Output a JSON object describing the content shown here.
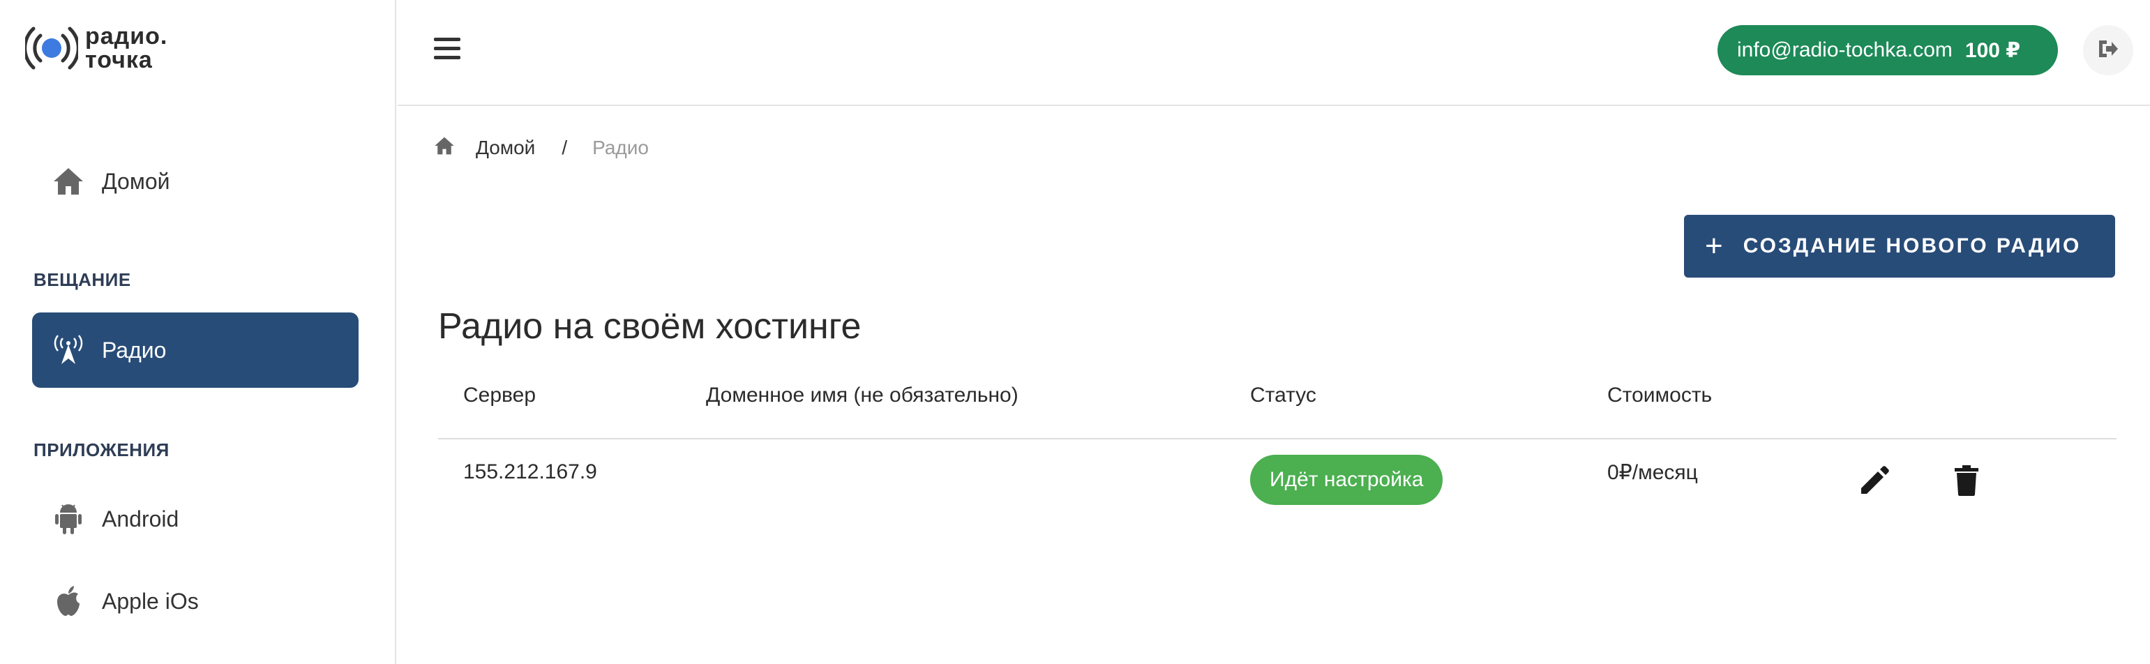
{
  "brand": {
    "line1": "радио.",
    "line2": "точка",
    "accent": "#3d7be0"
  },
  "sidebar": {
    "items": [
      {
        "label": "Домой",
        "icon": "home-icon"
      },
      {
        "label": "Радио",
        "icon": "antenna-icon",
        "active": true
      },
      {
        "label": "Android",
        "icon": "android-icon"
      },
      {
        "label": "Apple iOs",
        "icon": "apple-icon"
      }
    ],
    "sections": {
      "broadcast": "ВЕЩАНИЕ",
      "apps": "ПРИЛОЖЕНИЯ"
    }
  },
  "header": {
    "email": "info@radio-tochka.com",
    "balance": "100 ₽",
    "menu_icon": "hamburger-icon",
    "logout_icon": "logout-icon"
  },
  "breadcrumb": {
    "home": "Домой",
    "separator": "/",
    "current": "Радио"
  },
  "actions": {
    "create_plus": "+",
    "create_label": "СОЗДАНИЕ НОВОГО РАДИО"
  },
  "main": {
    "title": "Радио на своём хостинге",
    "columns": [
      "Сервер",
      "Доменное имя (не обязательно)",
      "Статус",
      "Стоимость"
    ],
    "rows": [
      {
        "server": "155.212.167.9",
        "domain": "",
        "status": "Идёт настройка",
        "cost": "0₽/месяц"
      }
    ]
  },
  "colors": {
    "primary": "#284c78",
    "pill": "#1d8a58",
    "status_ok": "#4caf50"
  }
}
